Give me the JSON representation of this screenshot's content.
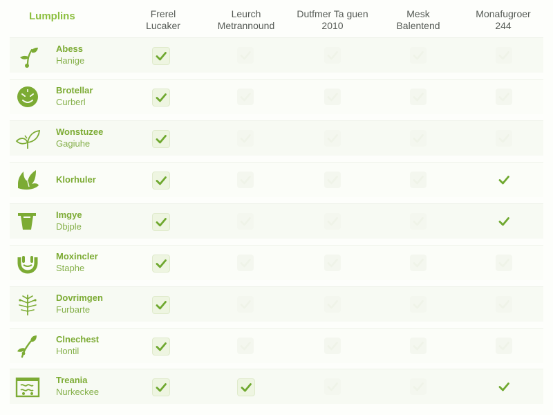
{
  "header": {
    "app_title": "Lumplins",
    "columns": [
      {
        "line1": "Frerel",
        "line2": "Lucaker"
      },
      {
        "line1": "Leurch",
        "line2": "Metrannound"
      },
      {
        "line1": "Dutfmer Ta guen",
        "line2": "2010"
      },
      {
        "line1": "Mesk",
        "line2": "Balentend"
      },
      {
        "line1": "Monafugroer",
        "line2": "244"
      }
    ]
  },
  "colors": {
    "accent": "#7cab34",
    "check": "#6fa82f",
    "muted_check": "#d9e4cc"
  },
  "rows": [
    {
      "icon": "sprout-icon",
      "primary": "Abess",
      "secondary": "Hanige",
      "checks": [
        true,
        false,
        false,
        false,
        false
      ]
    },
    {
      "icon": "face-badge-icon",
      "primary": "Brotellar",
      "secondary": "Curberl",
      "checks": [
        true,
        false,
        false,
        false,
        false
      ]
    },
    {
      "icon": "leaf-outline-icon",
      "primary": "Wonstuzee",
      "secondary": "Gagiuhe",
      "checks": [
        true,
        false,
        false,
        false,
        false
      ]
    },
    {
      "icon": "hand-leaf-icon",
      "primary": "Klorhuler",
      "secondary": "",
      "checks": [
        true,
        false,
        false,
        false,
        true
      ]
    },
    {
      "icon": "planter-icon",
      "primary": "Imgye",
      "secondary": "Dbjple",
      "checks": [
        true,
        false,
        false,
        false,
        true
      ]
    },
    {
      "icon": "horseshoe-icon",
      "primary": "Moxincler",
      "secondary": "Staphe",
      "checks": [
        true,
        false,
        false,
        false,
        false
      ]
    },
    {
      "icon": "fern-icon",
      "primary": "Dovrimgen",
      "secondary": "Furbarte",
      "checks": [
        true,
        false,
        false,
        false,
        false
      ]
    },
    {
      "icon": "branch-icon",
      "primary": "Clnechest",
      "secondary": "Hontil",
      "checks": [
        true,
        false,
        false,
        false,
        false
      ]
    },
    {
      "icon": "basket-icon",
      "primary": "Treania",
      "secondary": "Nurkeckee",
      "checks": [
        true,
        true,
        false,
        false,
        true
      ]
    }
  ]
}
